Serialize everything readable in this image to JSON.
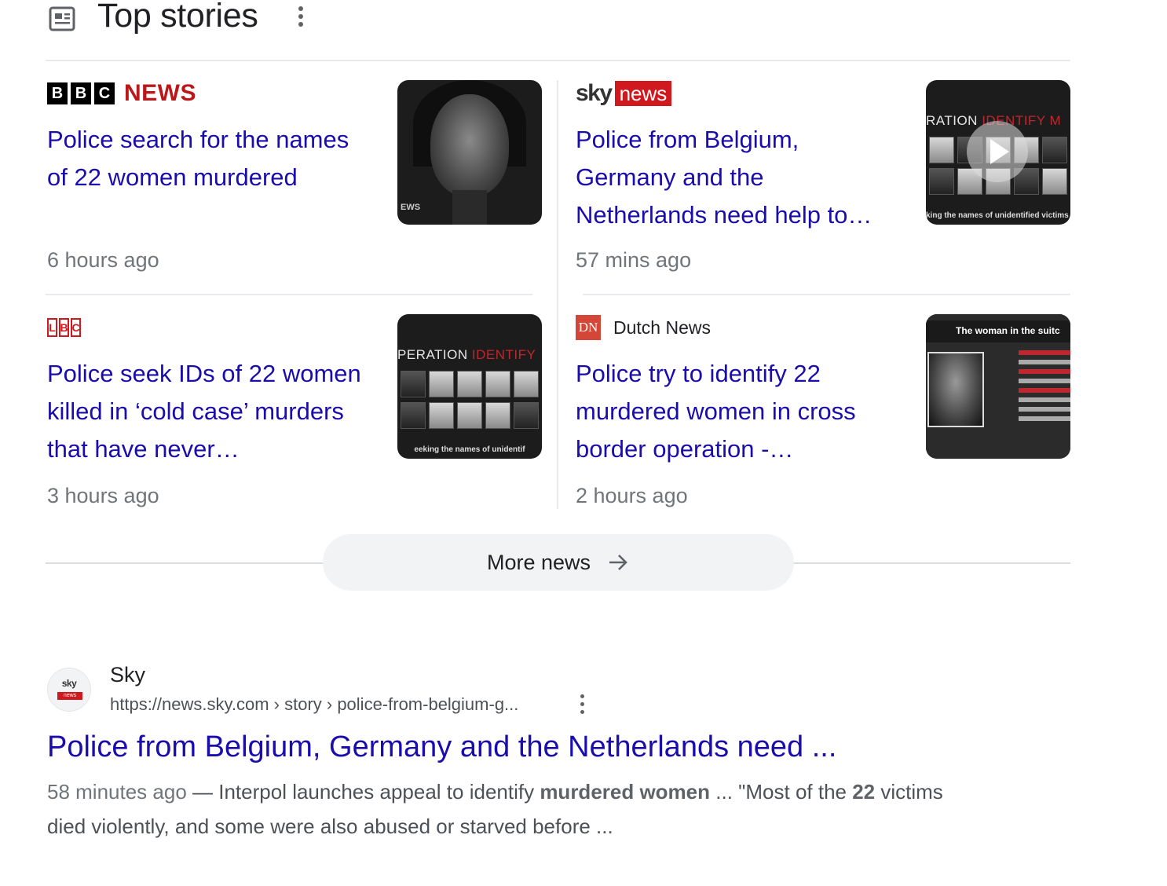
{
  "header": {
    "title": "Top stories",
    "icon": "newspaper-icon",
    "menu_icon": "more-vert-icon"
  },
  "stories": [
    {
      "source": "BBC NEWS",
      "logo_letters": [
        "B",
        "B",
        "C"
      ],
      "logo_word": "NEWS",
      "headline": "Police search for the names of 22 women murdered",
      "time": "6 hours ago",
      "thumb_caption": "EWS"
    },
    {
      "source": "sky news",
      "logo_word_1": "sky",
      "logo_word_2": "news",
      "headline": "Police from Belgium, Germany and the Netherlands need help to…",
      "time": "57 mins ago",
      "thumb_title_1": "RATION ",
      "thumb_title_2": "IDENTIFY M",
      "thumb_caption": "king the names of unidentified victims of murder",
      "has_video": true
    },
    {
      "source": "LBC",
      "logo_letters": [
        "L",
        "B",
        "C"
      ],
      "headline": "Police seek IDs of 22 women killed in ‘cold case’ murders that have never…",
      "time": "3 hours ago",
      "thumb_title_1": "PERATION ",
      "thumb_title_2": "IDENTIFY",
      "thumb_caption": "eeking the names of unidentif"
    },
    {
      "source": "Dutch News",
      "logo_letters": "DN",
      "headline": "Police try to identify 22 murdered women in cross border operation -…",
      "time": "2 hours ago",
      "thumb_title": "The woman in the suitc"
    }
  ],
  "more_news": {
    "label": "More news",
    "icon": "arrow-right-icon"
  },
  "result": {
    "site_name": "Sky",
    "favicon_text_1": "sky",
    "favicon_text_2": "news",
    "url": "https://news.sky.com › story › police-from-belgium-g...",
    "title": "Police from Belgium, Germany and the Netherlands need ...",
    "snippet_date": "58 minutes ago",
    "snippet_sep": " — ",
    "snippet_1": "Interpol launches appeal to identify ",
    "snippet_bold_1": "murdered women",
    "snippet_2": " ... \"Most of the ",
    "snippet_bold_2": "22",
    "snippet_3": " victims died violently, and some were also abused or starved before ..."
  },
  "colors": {
    "link": "#1a0dab",
    "bbc_red": "#bb1919",
    "sky_red": "#d0191f",
    "dn_red": "#d44638",
    "meta_gray": "#70757a"
  }
}
